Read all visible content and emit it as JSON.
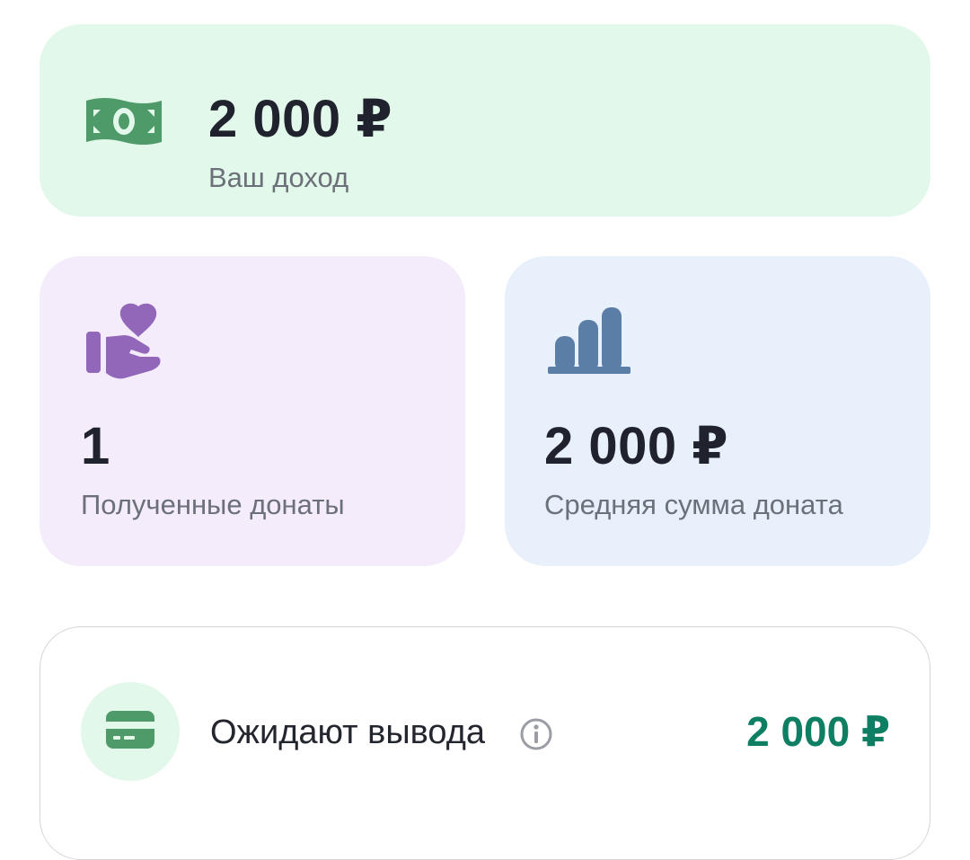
{
  "income": {
    "amount": "2 000 ₽",
    "label": "Ваш доход",
    "icon": "money-bill-icon"
  },
  "donations": {
    "count": "1",
    "label": "Полученные донаты",
    "icon": "heart-hand-icon"
  },
  "average": {
    "amount": "2 000 ₽",
    "label": "Средняя сумма доната",
    "icon": "bar-chart-icon"
  },
  "pending": {
    "title": "Ожидают вывода",
    "amount": "2 000 ₽",
    "icon": "card-icon",
    "info_icon": "info-icon"
  },
  "colors": {
    "income_bg": "#e2f8ea",
    "donations_bg": "#f4ecfa",
    "average_bg": "#e7f0fb",
    "money_icon": "#4e9a69",
    "heart_icon": "#9266b8",
    "chart_icon": "#5b7ea6",
    "pending_amount": "#0f7f63"
  }
}
